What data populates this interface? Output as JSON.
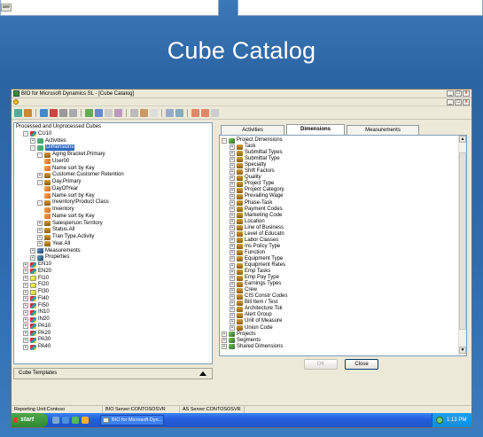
{
  "hero": {
    "title": "Cube Catalog"
  },
  "prev": {
    "button_label": "ave"
  },
  "window": {
    "title": "BIO for Microsoft Dynamics SL - [Cube Catalog]",
    "controls": [
      "_",
      "□",
      "x"
    ]
  },
  "left_tree": [
    {
      "indent": 0,
      "icon": "none",
      "label": "Processed and Unprocessed Cubes",
      "expander": ""
    },
    {
      "indent": 1,
      "icon": "cube",
      "label": "CU10",
      "expander": "-"
    },
    {
      "indent": 2,
      "icon": "dim",
      "label": "Activities",
      "expander": "+"
    },
    {
      "indent": 2,
      "icon": "dim",
      "label": "Dimensions",
      "expander": "-",
      "selected": true
    },
    {
      "indent": 3,
      "icon": "db",
      "label": "Aging Bracket.Primary",
      "expander": "-"
    },
    {
      "indent": 4,
      "icon": "lvl",
      "label": "User00",
      "expander": ""
    },
    {
      "indent": 4,
      "icon": "lvl",
      "label": "Name sort by Key",
      "expander": ""
    },
    {
      "indent": 3,
      "icon": "db",
      "label": "Customer.Customer Retention",
      "expander": "+"
    },
    {
      "indent": 3,
      "icon": "db",
      "label": "Day.Primary",
      "expander": "-"
    },
    {
      "indent": 4,
      "icon": "lvl",
      "label": "DayOfYear",
      "expander": ""
    },
    {
      "indent": 4,
      "icon": "lvl",
      "label": "Name sort by Key",
      "expander": ""
    },
    {
      "indent": 3,
      "icon": "db",
      "label": "Inventory/Product Class",
      "expander": "-"
    },
    {
      "indent": 4,
      "icon": "lvl",
      "label": "Inventory",
      "expander": ""
    },
    {
      "indent": 4,
      "icon": "lvl",
      "label": "Name sort by Key",
      "expander": ""
    },
    {
      "indent": 3,
      "icon": "db",
      "label": "Salesperson.Territory",
      "expander": "+"
    },
    {
      "indent": 3,
      "icon": "db",
      "label": "Status.All",
      "expander": "+"
    },
    {
      "indent": 3,
      "icon": "db",
      "label": "Tran Type.Activity",
      "expander": "+"
    },
    {
      "indent": 3,
      "icon": "db",
      "label": "Year.All",
      "expander": "+"
    },
    {
      "indent": 2,
      "icon": "mea",
      "label": "Measurements",
      "expander": "+"
    },
    {
      "indent": 2,
      "icon": "mea",
      "label": "Properties",
      "expander": "+"
    },
    {
      "indent": 1,
      "icon": "cube",
      "label": "EN10",
      "expander": "+"
    },
    {
      "indent": 1,
      "icon": "cube",
      "label": "EN20",
      "expander": "+"
    },
    {
      "indent": 1,
      "icon": "yel",
      "label": "FI10",
      "expander": "+"
    },
    {
      "indent": 1,
      "icon": "yel",
      "label": "FI20",
      "expander": "+"
    },
    {
      "indent": 1,
      "icon": "yel",
      "label": "FI30",
      "expander": "+"
    },
    {
      "indent": 1,
      "icon": "cube",
      "label": "FI40",
      "expander": "+"
    },
    {
      "indent": 1,
      "icon": "cube",
      "label": "FI50",
      "expander": "+"
    },
    {
      "indent": 1,
      "icon": "cube",
      "label": "IN10",
      "expander": "+"
    },
    {
      "indent": 1,
      "icon": "cube",
      "label": "IN20",
      "expander": "+"
    },
    {
      "indent": 1,
      "icon": "cube",
      "label": "PA10",
      "expander": "+"
    },
    {
      "indent": 1,
      "icon": "cube",
      "label": "PA20",
      "expander": "+"
    },
    {
      "indent": 1,
      "icon": "cube",
      "label": "PA30",
      "expander": "+"
    },
    {
      "indent": 1,
      "icon": "cube",
      "label": "PA40",
      "expander": "+"
    }
  ],
  "cube_templates_label": "Cube Templates",
  "tabs": [
    {
      "label": "Activities",
      "active": false
    },
    {
      "label": "Dimensions",
      "active": true
    },
    {
      "label": "Measurements",
      "active": false
    }
  ],
  "right_tree": [
    {
      "indent": 0,
      "icon": "grn",
      "label": "Project Dimensions",
      "expander": "-"
    },
    {
      "indent": 1,
      "icon": "db",
      "label": "Task",
      "expander": "+"
    },
    {
      "indent": 1,
      "icon": "db",
      "label": "Submittal Types",
      "expander": "+"
    },
    {
      "indent": 1,
      "icon": "db",
      "label": "Submittal Type",
      "expander": "+"
    },
    {
      "indent": 1,
      "icon": "db",
      "label": "Specialty",
      "expander": "+"
    },
    {
      "indent": 1,
      "icon": "db",
      "label": "Shift Factors",
      "expander": "+"
    },
    {
      "indent": 1,
      "icon": "db",
      "label": "Quality",
      "expander": "+"
    },
    {
      "indent": 1,
      "icon": "db",
      "label": "Project Type",
      "expander": "+"
    },
    {
      "indent": 1,
      "icon": "db",
      "label": "Project Category",
      "expander": "+"
    },
    {
      "indent": 1,
      "icon": "db",
      "label": "Prevailing Wage",
      "expander": "+"
    },
    {
      "indent": 1,
      "icon": "db",
      "label": "Phase-Task",
      "expander": "+"
    },
    {
      "indent": 1,
      "icon": "db",
      "label": "Payment Codes",
      "expander": "+"
    },
    {
      "indent": 1,
      "icon": "db",
      "label": "Marketing Code",
      "expander": "+"
    },
    {
      "indent": 1,
      "icon": "db",
      "label": "Location",
      "expander": "+"
    },
    {
      "indent": 1,
      "icon": "db",
      "label": "Line of Business",
      "expander": "+"
    },
    {
      "indent": 1,
      "icon": "db",
      "label": "Level of Educatn",
      "expander": "+"
    },
    {
      "indent": 1,
      "icon": "db",
      "label": "Labor Classes",
      "expander": "+"
    },
    {
      "indent": 1,
      "icon": "db",
      "label": "Ins Policy Type",
      "expander": "+"
    },
    {
      "indent": 1,
      "icon": "db",
      "label": "Function",
      "expander": "+"
    },
    {
      "indent": 1,
      "icon": "db",
      "label": "Equipment Type",
      "expander": "+"
    },
    {
      "indent": 1,
      "icon": "db",
      "label": "Equipment Rates",
      "expander": "+"
    },
    {
      "indent": 1,
      "icon": "db",
      "label": "Emp Tasks",
      "expander": "+"
    },
    {
      "indent": 1,
      "icon": "db",
      "label": "Emp Pay Type",
      "expander": "+"
    },
    {
      "indent": 1,
      "icon": "db",
      "label": "Earnings Types",
      "expander": "+"
    },
    {
      "indent": 1,
      "icon": "db",
      "label": "Crew",
      "expander": "+"
    },
    {
      "indent": 1,
      "icon": "db",
      "label": "CIS Constr Codes",
      "expander": "+"
    },
    {
      "indent": 1,
      "icon": "db",
      "label": "Bill Item / Test",
      "expander": "+"
    },
    {
      "indent": 1,
      "icon": "db",
      "label": "Architecture Tsk",
      "expander": "+"
    },
    {
      "indent": 1,
      "icon": "db",
      "label": "Alert Group",
      "expander": "+"
    },
    {
      "indent": 1,
      "icon": "db",
      "label": "Unit of Measure",
      "expander": "+"
    },
    {
      "indent": 1,
      "icon": "db",
      "label": "Union Code",
      "expander": "+"
    },
    {
      "indent": 0,
      "icon": "grn",
      "label": "Projects",
      "expander": "+"
    },
    {
      "indent": 0,
      "icon": "grn",
      "label": "Segments",
      "expander": "+"
    },
    {
      "indent": 0,
      "icon": "grn",
      "label": "Shared Dimensions",
      "expander": "+"
    }
  ],
  "buttons": {
    "ok": "OK",
    "close": "Close"
  },
  "status": {
    "unit": "Reporting Unit:Contoso",
    "bio": "BIO Server:CONTOSOSVR",
    "as": "AS Server:CONTOSOSVR"
  },
  "taskbar": {
    "start": "start",
    "task": "BIO for Microsoft Dyn...",
    "clock": "1:13 PM"
  }
}
